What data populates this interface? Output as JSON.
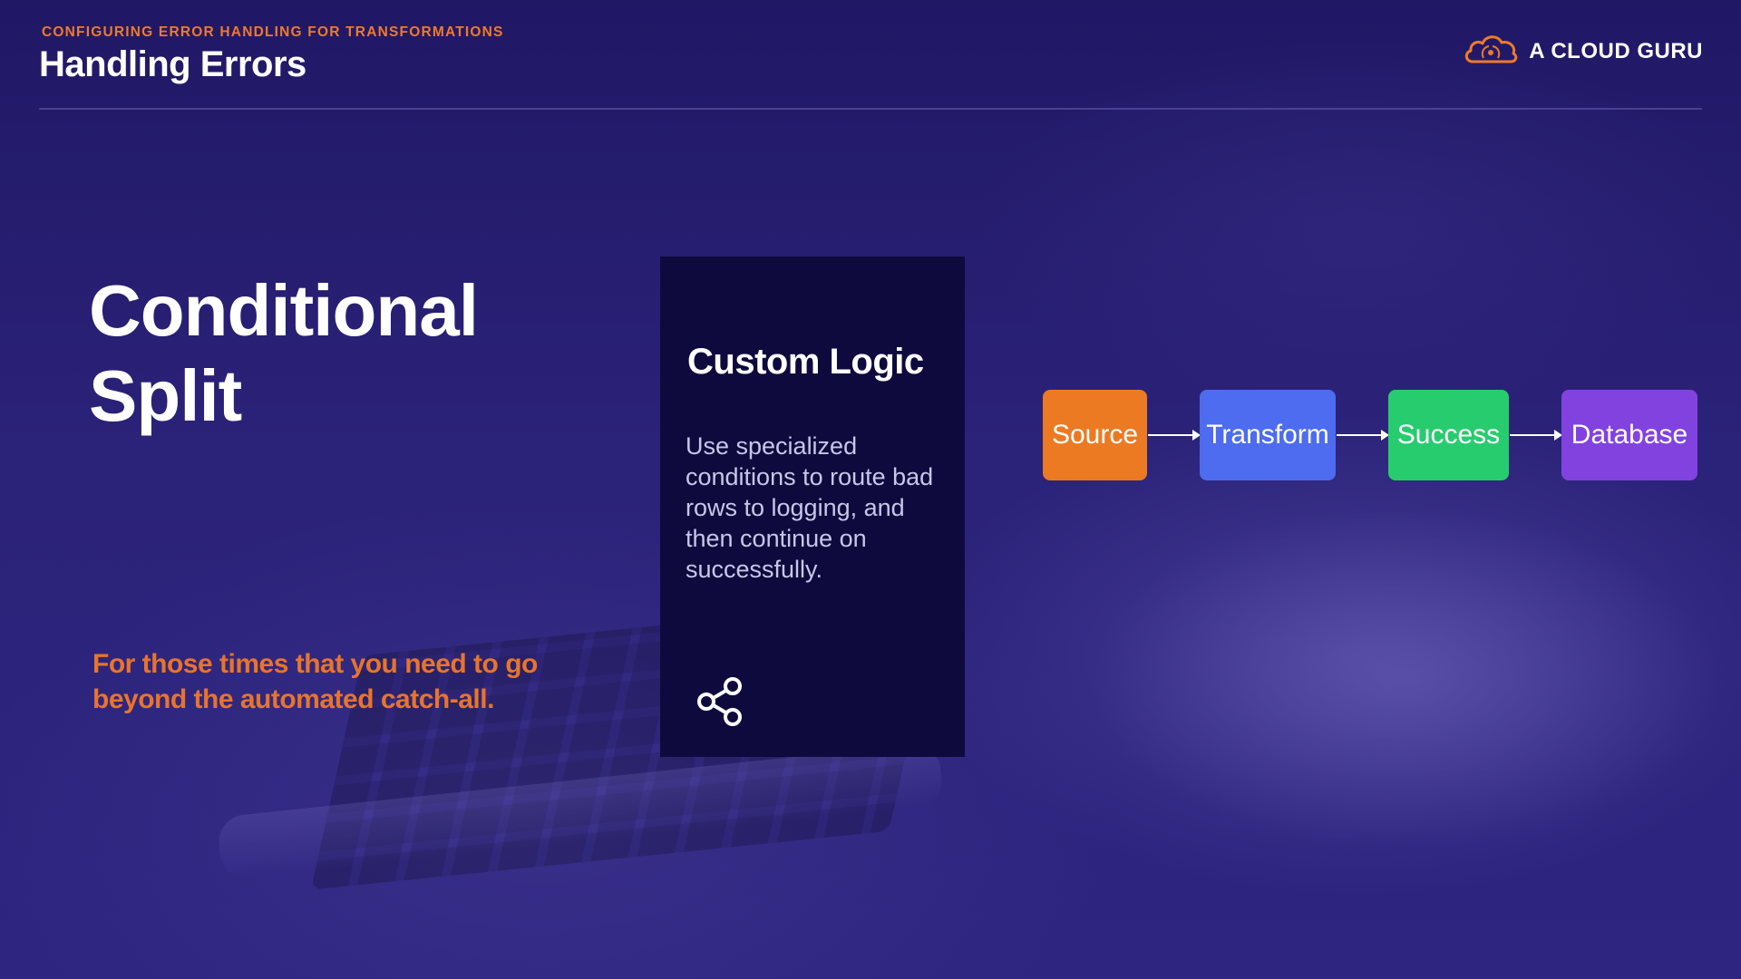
{
  "header": {
    "subtitle": "CONFIGURING ERROR HANDLING FOR TRANSFORMATIONS",
    "title": "Handling Errors"
  },
  "brand": {
    "name": "A CLOUD GURU",
    "logo_icon": "cloud-logo-icon",
    "accent_color": "#f07a2a"
  },
  "main": {
    "title_line1": "Conditional",
    "title_line2": "Split",
    "tagline": "For those times that you need to go beyond the automated catch-all."
  },
  "card": {
    "title": "Custom Logic",
    "body": "Use specialized conditions to route bad rows to logging, and then continue on successfully.",
    "icon": "share-icon"
  },
  "flow": {
    "steps": [
      {
        "label": "Source",
        "color": "#ec7a22"
      },
      {
        "label": "Transform",
        "color": "#4d6cf0"
      },
      {
        "label": "Success",
        "color": "#27cc6e"
      },
      {
        "label": "Database",
        "color": "#8242e0"
      }
    ]
  }
}
